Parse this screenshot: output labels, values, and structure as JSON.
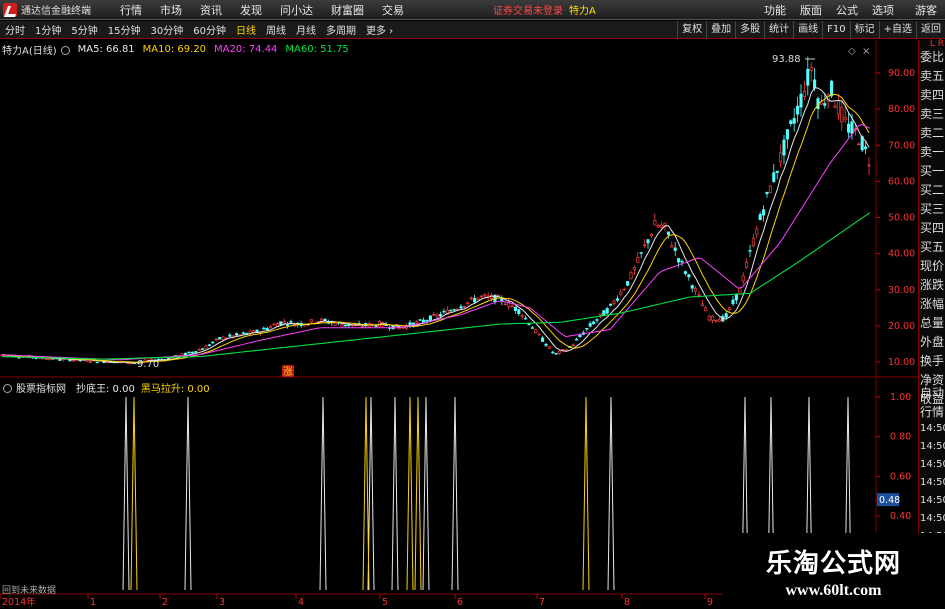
{
  "titlebar": {
    "app_name": "通达信金融终端",
    "menu": [
      "行情",
      "市场",
      "资讯",
      "发现",
      "问小达",
      "财富圈",
      "交易"
    ],
    "notice": "证券交易未登录",
    "stock_name": "特力A",
    "right_menu": [
      "功能",
      "版面",
      "公式",
      "选项"
    ],
    "guest": "游客"
  },
  "toolbar": {
    "periods": [
      "分时",
      "1分钟",
      "5分钟",
      "15分钟",
      "30分钟",
      "60分钟",
      "日线",
      "周线",
      "月线",
      "多周期"
    ],
    "active_period": "日线",
    "more": "更多",
    "tools": [
      "复权",
      "叠加",
      "多股",
      "统计",
      "画线",
      "F10",
      "标记",
      "+自选",
      "返回"
    ]
  },
  "main_header": {
    "stock": "特力A(日线)",
    "ma": [
      {
        "label": "MA5: 66.81",
        "color": "#e8e8e8"
      },
      {
        "label": "MA10: 69.20",
        "color": "#ffd400"
      },
      {
        "label": "MA20: 74.44",
        "color": "#ff40ff"
      },
      {
        "label": "MA60: 51.75",
        "color": "#00e040"
      }
    ]
  },
  "sub_header": {
    "indicator": "股票指标网",
    "lines": [
      {
        "label": "抄底王: 0.00",
        "color": "#e8e8e8"
      },
      {
        "label": "黑马拉升: 0.00",
        "color": "#ffd400"
      }
    ]
  },
  "side_panel": {
    "lr": "L R",
    "items": [
      "委比",
      "卖五",
      "卖四",
      "卖三",
      "卖二",
      "卖一",
      "买一",
      "买二",
      "买三",
      "买四",
      "买五",
      "现价",
      "涨跌",
      "涨幅",
      "总量",
      "外盘",
      "换手",
      "净资",
      "收益"
    ],
    "items2": [
      "自动",
      "行情"
    ],
    "times": [
      "14:50",
      "14:50",
      "14:50",
      "14:50",
      "14:50",
      "14:50",
      "14:50",
      "14:50",
      "14:50",
      "14:50"
    ]
  },
  "chart_data": [
    {
      "type": "candlestick",
      "title": "特力A(日线)",
      "ylim": [
        9,
        100
      ],
      "yticks": [
        10.0,
        20.0,
        30.0,
        40.0,
        50.0,
        60.0,
        70.0,
        80.0,
        90.0
      ],
      "high_label": "93.88",
      "low_label": "9.70",
      "marker_label": "涨",
      "x_labels": [
        "2014年",
        "1",
        "2",
        "3",
        "4",
        "5",
        "6",
        "7",
        "8",
        "9"
      ],
      "series_names": [
        "MA5",
        "MA10",
        "MA20",
        "MA60"
      ],
      "price_key": [
        [
          0,
          12.0
        ],
        [
          20,
          11.6
        ],
        [
          40,
          11.2
        ],
        [
          60,
          10.8
        ],
        [
          80,
          10.5
        ],
        [
          100,
          10.2
        ],
        [
          120,
          10.0
        ],
        [
          135,
          9.8
        ],
        [
          150,
          10.4
        ],
        [
          170,
          11.0
        ],
        [
          190,
          12.5
        ],
        [
          205,
          14.0
        ],
        [
          220,
          16.5
        ],
        [
          240,
          17.5
        ],
        [
          260,
          18.5
        ],
        [
          280,
          21.0
        ],
        [
          300,
          20.5
        ],
        [
          320,
          21.5
        ],
        [
          340,
          20.5
        ],
        [
          360,
          20.0
        ],
        [
          380,
          20.5
        ],
        [
          400,
          19.5
        ],
        [
          420,
          21.0
        ],
        [
          440,
          23.0
        ],
        [
          460,
          25.5
        ],
        [
          480,
          28.0
        ],
        [
          500,
          27.5
        ],
        [
          520,
          24.0
        ],
        [
          540,
          17.0
        ],
        [
          555,
          12.0
        ],
        [
          570,
          14.0
        ],
        [
          590,
          20.0
        ],
        [
          610,
          25.0
        ],
        [
          630,
          33.0
        ],
        [
          645,
          42.0
        ],
        [
          655,
          48.0
        ],
        [
          665,
          47.0
        ],
        [
          680,
          38.0
        ],
        [
          695,
          30.0
        ],
        [
          710,
          22.0
        ],
        [
          725,
          22.0
        ],
        [
          740,
          30.0
        ],
        [
          755,
          45.0
        ],
        [
          770,
          58.0
        ],
        [
          785,
          70.0
        ],
        [
          800,
          82.0
        ],
        [
          812,
          92.0
        ],
        [
          820,
          80.0
        ],
        [
          830,
          86.0
        ],
        [
          845,
          76.0
        ],
        [
          860,
          72.0
        ],
        [
          872,
          64.0
        ]
      ],
      "ma60_key": [
        [
          0,
          11.5
        ],
        [
          100,
          10.8
        ],
        [
          200,
          11.5
        ],
        [
          300,
          14.5
        ],
        [
          400,
          17.5
        ],
        [
          500,
          20.5
        ],
        [
          560,
          21.0
        ],
        [
          620,
          23.5
        ],
        [
          690,
          28.0
        ],
        [
          750,
          29.0
        ],
        [
          800,
          38.0
        ],
        [
          872,
          51.75
        ]
      ],
      "ma20_key": [
        [
          0,
          12.0
        ],
        [
          120,
          10.6
        ],
        [
          200,
          12.0
        ],
        [
          260,
          16.0
        ],
        [
          320,
          19.5
        ],
        [
          400,
          19.5
        ],
        [
          460,
          23.0
        ],
        [
          500,
          27.0
        ],
        [
          530,
          25.0
        ],
        [
          565,
          17.0
        ],
        [
          610,
          19.0
        ],
        [
          660,
          35.0
        ],
        [
          700,
          39.0
        ],
        [
          740,
          30.0
        ],
        [
          780,
          43.0
        ],
        [
          830,
          65.0
        ],
        [
          860,
          76.0
        ],
        [
          872,
          74.44
        ]
      ]
    },
    {
      "type": "line",
      "title": "股票指标网",
      "ylim": [
        0,
        1
      ],
      "yticks": [
        1.0,
        0.8,
        0.6,
        0.48,
        0.4
      ],
      "current_value_label": "0.48",
      "series": [
        {
          "name": "抄底王",
          "color": "#e8e8e8",
          "spike_x": [
            126,
            188,
            323,
            371,
            395,
            426,
            455,
            611,
            745,
            771,
            809,
            848
          ]
        },
        {
          "name": "黑马拉升",
          "color": "#ffd400",
          "spike_x": [
            134,
            366,
            410,
            418,
            586
          ]
        }
      ],
      "spike_value": 1.0
    }
  ],
  "footer": {
    "back_label": "回到未来数据"
  },
  "watermark": {
    "title": "乐淘公式网",
    "url": "www.60lt.com"
  }
}
